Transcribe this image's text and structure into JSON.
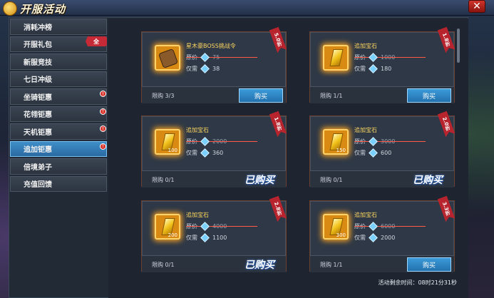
{
  "window": {
    "title": "开服活动",
    "close_label": "✕"
  },
  "sidebar": {
    "items": [
      {
        "label": "消耗冲榜",
        "active": false,
        "dot": false
      },
      {
        "label": "开服礼包",
        "active": false,
        "dot": false
      },
      {
        "label": "新服竞技",
        "active": false,
        "dot": false
      },
      {
        "label": "七日冲级",
        "active": false,
        "dot": false
      },
      {
        "label": "坐骑钜惠",
        "active": false,
        "dot": true
      },
      {
        "label": "花翎钜惠",
        "active": false,
        "dot": true
      },
      {
        "label": "天机钜惠",
        "active": false,
        "dot": true
      },
      {
        "label": "追加钜惠",
        "active": true,
        "dot": true
      },
      {
        "label": "倍境弟子",
        "active": false,
        "dot": false
      },
      {
        "label": "充值回馈",
        "active": false,
        "dot": false
      }
    ],
    "tag_label": "全"
  },
  "cards": [
    {
      "name": "星木豪BOSS挑战令",
      "orig_label": "原价",
      "orig_price": "75",
      "now_label": "仅需",
      "now_price": "38",
      "limit": "限购 3/3",
      "state": "buy",
      "button": "购买",
      "discount": "5.0折",
      "icon": "scroll-icon",
      "qty": ""
    },
    {
      "name": "追加宝石",
      "orig_label": "原价",
      "orig_price": "1000",
      "now_label": "仅需",
      "now_price": "180",
      "limit": "限购 1/1",
      "state": "buy",
      "button": "购买",
      "discount": "1.8折",
      "icon": "gem-icon",
      "qty": ""
    },
    {
      "name": "追加宝石",
      "orig_label": "原价",
      "orig_price": "2000",
      "now_label": "仅需",
      "now_price": "360",
      "limit": "限购 0/1",
      "state": "bought",
      "button": "已购买",
      "discount": "1.8折",
      "icon": "gem-icon",
      "qty": "100"
    },
    {
      "name": "追加宝石",
      "orig_label": "原价",
      "orig_price": "3000",
      "now_label": "仅需",
      "now_price": "600",
      "limit": "限购 0/1",
      "state": "bought",
      "button": "已购买",
      "discount": "2.0折",
      "icon": "gem-icon",
      "qty": "150"
    },
    {
      "name": "追加宝石",
      "orig_label": "原价",
      "orig_price": "4000",
      "now_label": "仅需",
      "now_price": "1100",
      "limit": "限购 0/1",
      "state": "bought",
      "button": "已购买",
      "discount": "2.8折",
      "icon": "gem-icon",
      "qty": "200"
    },
    {
      "name": "追加宝石",
      "orig_label": "原价",
      "orig_price": "6000",
      "now_label": "仅需",
      "now_price": "2000",
      "limit": "限购 1/1",
      "state": "buy",
      "button": "购买",
      "discount": "3.3折",
      "icon": "gem-icon",
      "qty": "300"
    }
  ],
  "footer": {
    "timer": "活动剩余时间：08时21分31秒"
  }
}
